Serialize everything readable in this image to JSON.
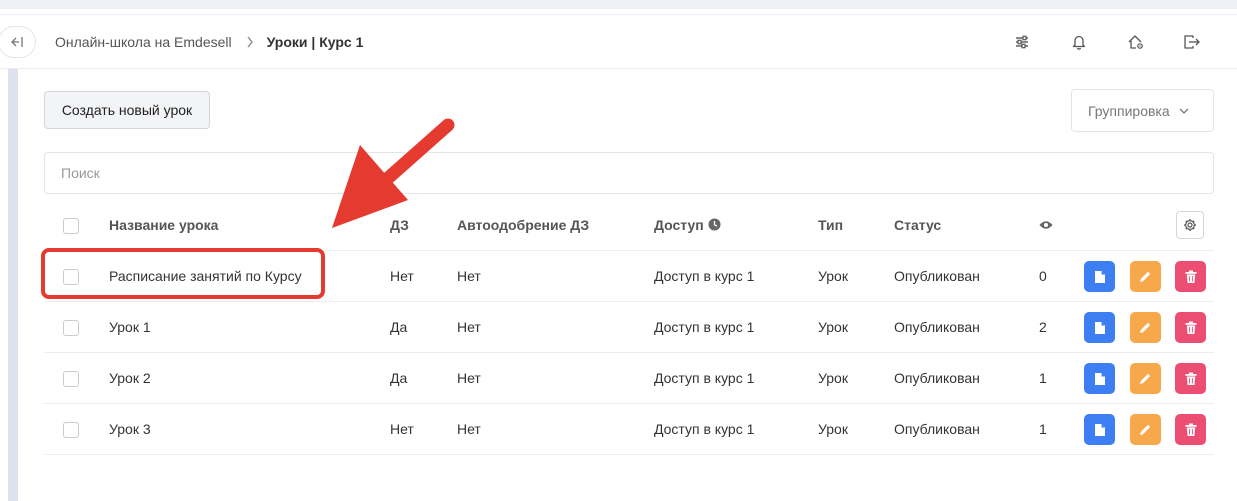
{
  "header": {
    "breadcrumb": [
      {
        "label": "Онлайн-школа на Emdesell"
      },
      {
        "label": "Уроки | Курс 1"
      }
    ]
  },
  "toolbar": {
    "create_label": "Создать новый урок",
    "group_label": "Группировка"
  },
  "search": {
    "placeholder": "Поиск"
  },
  "table": {
    "columns": {
      "name": "Название урока",
      "hw": "ДЗ",
      "auto": "Автоодобрение ДЗ",
      "access": "Доступ",
      "type": "Тип",
      "status": "Статус"
    },
    "rows": [
      {
        "name": "Расписание занятий по Курсу",
        "hw": "Нет",
        "auto": "Нет",
        "access": "Доступ в курс 1",
        "type": "Урок",
        "status": "Опубликован",
        "views": "0"
      },
      {
        "name": "Урок 1",
        "hw": "Да",
        "auto": "Нет",
        "access": "Доступ в курс 1",
        "type": "Урок",
        "status": "Опубликован",
        "views": "2"
      },
      {
        "name": "Урок 2",
        "hw": "Да",
        "auto": "Нет",
        "access": "Доступ в курс 1",
        "type": "Урок",
        "status": "Опубликован",
        "views": "1"
      },
      {
        "name": "Урок 3",
        "hw": "Нет",
        "auto": "Нет",
        "access": "Доступ в курс 1",
        "type": "Урок",
        "status": "Опубликован",
        "views": "1"
      }
    ]
  },
  "icons": {
    "collapse": "collapse-sidebar-icon",
    "chevron_right": "chevron-right-icon",
    "filters": "sliders-icon",
    "notifications": "bell-icon",
    "home_settings": "home-gear-icon",
    "logout": "logout-icon",
    "views": "eye-icon",
    "settings": "gear-icon",
    "view": "document-icon",
    "edit": "pencil-icon",
    "delete": "trash-icon"
  },
  "colors": {
    "view_button": "#3d7ef2",
    "edit_button": "#f7a84a",
    "delete_button": "#ec4d72",
    "annotation": "#e53a2f"
  }
}
